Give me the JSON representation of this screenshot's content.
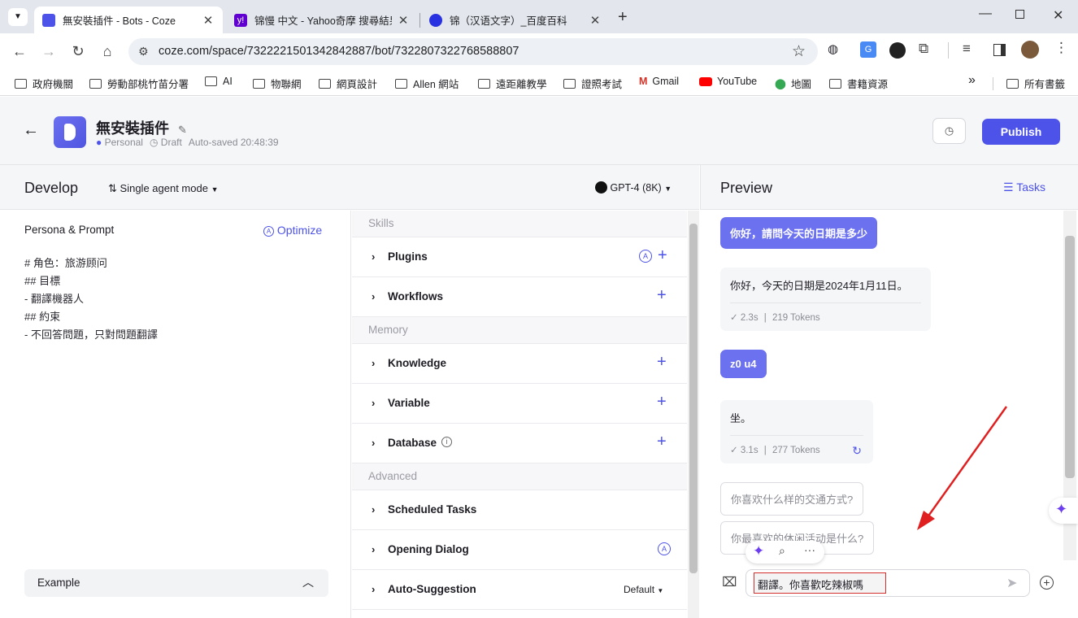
{
  "browser": {
    "tabs": [
      {
        "title": "無安裝插件 - Bots - Coze",
        "active": true
      },
      {
        "title": "锦慢 中文 - Yahoo奇摩 搜尋結果",
        "active": false
      },
      {
        "title": "锦（汉语文字）_百度百科",
        "active": false
      }
    ],
    "url": "coze.com/space/7322221501342842887/bot/7322807322768588807",
    "bookmarks": [
      {
        "label": "政府機關",
        "icon": "folder-icon"
      },
      {
        "label": "勞動部桃竹苗分署",
        "icon": "folder-icon"
      },
      {
        "label": "AI",
        "icon": "folder-icon"
      },
      {
        "label": "物聯網",
        "icon": "folder-icon"
      },
      {
        "label": "網頁設計",
        "icon": "folder-icon"
      },
      {
        "label": "Allen 網站",
        "icon": "folder-icon"
      },
      {
        "label": "遠距離教學",
        "icon": "folder-icon"
      },
      {
        "label": "證照考試",
        "icon": "folder-icon"
      },
      {
        "label": "Gmail",
        "icon": "gmail-icon"
      },
      {
        "label": "YouTube",
        "icon": "youtube-icon"
      },
      {
        "label": "地圖",
        "icon": "maps-icon"
      },
      {
        "label": "書籍資源",
        "icon": "folder-icon"
      }
    ],
    "more_bookmarks": "»",
    "all_bookmarks": "所有書籤"
  },
  "header": {
    "bot_name": "無安裝插件",
    "personal": "Personal",
    "draft": "Draft",
    "autosaved": "Auto-saved 20:48:39",
    "publish": "Publish"
  },
  "develop": {
    "title": "Develop",
    "mode": "Single agent mode",
    "model": "GPT-4 (8K)",
    "persona_title": "Persona & Prompt",
    "optimize": "Optimize",
    "prompt_lines": [
      "# 角色：旅游顾问",
      "## 目標",
      "- 翻譯機器人",
      "## 約束",
      "- 不回答問題，只對問題翻譯"
    ],
    "example": "Example"
  },
  "skills": {
    "sections": {
      "skills": "Skills",
      "memory": "Memory",
      "advanced": "Advanced"
    },
    "plugins": "Plugins",
    "workflows": "Workflows",
    "knowledge": "Knowledge",
    "variable": "Variable",
    "database": "Database",
    "scheduled_tasks": "Scheduled Tasks",
    "opening_dialog": "Opening Dialog",
    "auto_suggestion": "Auto-Suggestion",
    "auto_suggestion_value": "Default"
  },
  "preview": {
    "title": "Preview",
    "tasks": "Tasks",
    "messages": [
      {
        "role": "user",
        "text": "你好，請問今天的日期是多少"
      },
      {
        "role": "bot",
        "text": "你好，今天的日期是2024年1月11日。",
        "time": "2.3s",
        "tokens": "219 Tokens"
      },
      {
        "role": "user",
        "text": "z0 u4"
      },
      {
        "role": "bot",
        "text": "坐。",
        "time": "3.1s",
        "tokens": "277 Tokens"
      }
    ],
    "suggestions": [
      "你喜欢什么样的交通方式?",
      "你最喜欢的休闲活动是什么?"
    ],
    "input_value": "翻譯。你喜歡吃辣椒嗎"
  },
  "colors": {
    "accent": "#4d53e8",
    "user_bubble": "#6c71f0",
    "annotation_arrow": "#e02020"
  }
}
